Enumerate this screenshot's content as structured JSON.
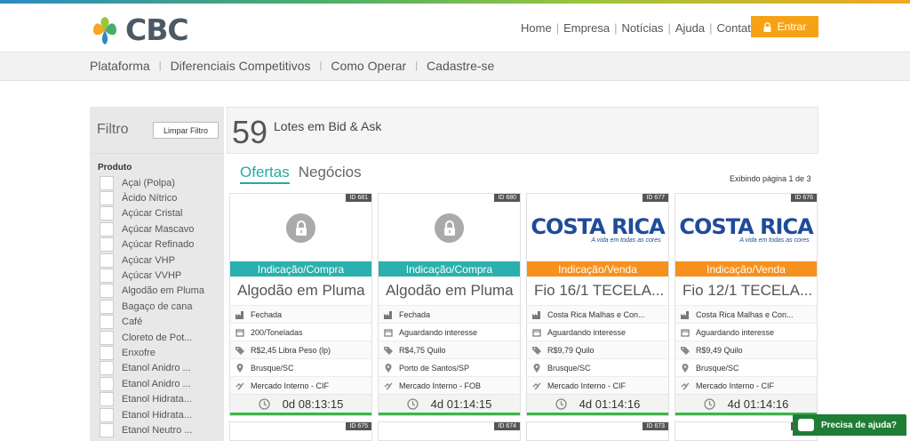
{
  "brand": {
    "name": "CBC"
  },
  "topnav": {
    "items": [
      "Home",
      "Empresa",
      "Notícias",
      "Ajuda",
      "Contato"
    ],
    "login_label": "Entrar"
  },
  "subnav": {
    "items": [
      "Plataforma",
      "Diferenciais Competitivos",
      "Como Operar",
      "Cadastre-se"
    ]
  },
  "filter": {
    "title": "Filtro",
    "clear_label": "Limpar Filtro",
    "section_title": "Produto",
    "products": [
      "Açai (Polpa)",
      "Àcido Nítrico",
      "Açúcar Cristal",
      "Açúcar Mascavo",
      "Açúcar Refinado",
      "Açúcar VHP",
      "Açúcar VVHP",
      "Algodão em Pluma",
      "Bagaço de cana",
      "Café",
      "Cloreto de Pot...",
      "Enxofre",
      "Etanol Anidro ...",
      "Etanol Anidro ...",
      "Etanol Hidrata...",
      "Etanol Hidrata...",
      "Etanol Neutro ..."
    ]
  },
  "lots": {
    "count": "59",
    "label": "Lotes em Bid & Ask"
  },
  "tabs": [
    {
      "label": "Ofertas",
      "active": true
    },
    {
      "label": "Negócios",
      "active": false
    }
  ],
  "page_info": "Exibindo página 1 de 3",
  "cards": [
    {
      "id": "ID 681",
      "image": "lock-icon",
      "type": "Indicação/Compra",
      "kind": "compra",
      "title": "Algodão em Pluma",
      "status": "Fechada",
      "quantity": "200/Toneladas",
      "price": "R$2,45 Libra Peso (lp)",
      "location": "Brusque/SC",
      "market": "Mercado Interno - CIF",
      "timer": "0d 08:13:15"
    },
    {
      "id": "ID 680",
      "image": "lock-icon",
      "type": "Indicação/Compra",
      "kind": "compra",
      "title": "Algodão em Pluma",
      "status": "Fechada",
      "quantity": "Aguardando interesse",
      "price": "R$4,75 Quilo",
      "location": "Porto de Santos/SP",
      "market": "Mercado Interno - FOB",
      "timer": "4d 01:14:15"
    },
    {
      "id": "ID 677",
      "image": "costa-rica-logo",
      "logo_name": "COSTA RICA",
      "logo_tagline": "A vida em todas as cores",
      "type": "Indicação/Venda",
      "kind": "venda",
      "title": "Fio 16/1 TECELA...",
      "status": "Costa Rica Malhas e Con...",
      "quantity": "Aguardando interesse",
      "price": "R$9,79 Quilo",
      "location": "Brusque/SC",
      "market": "Mercado Interno - CIF",
      "timer": "4d 01:14:16"
    },
    {
      "id": "ID 676",
      "image": "costa-rica-logo",
      "logo_name": "COSTA RICA",
      "logo_tagline": "A vida em todas as cores",
      "type": "Indicação/Venda",
      "kind": "venda",
      "title": "Fio 12/1 TECELA...",
      "status": "Costa Rica Malhas e Con...",
      "quantity": "Aguardando interesse",
      "price": "R$9,49 Quilo",
      "location": "Brusque/SC",
      "market": "Mercado Interno - CIF",
      "timer": "4d 01:14:16"
    }
  ],
  "next_cards": [
    "ID 675",
    "ID 674",
    "ID 673",
    "ID 672"
  ],
  "help": {
    "label": "Precisa de ajuda?"
  },
  "colors": {
    "accent_teal": "#2ab0ad",
    "accent_orange": "#f7911e",
    "login_orange": "#f7a215",
    "timer_green": "#3cb54a"
  }
}
